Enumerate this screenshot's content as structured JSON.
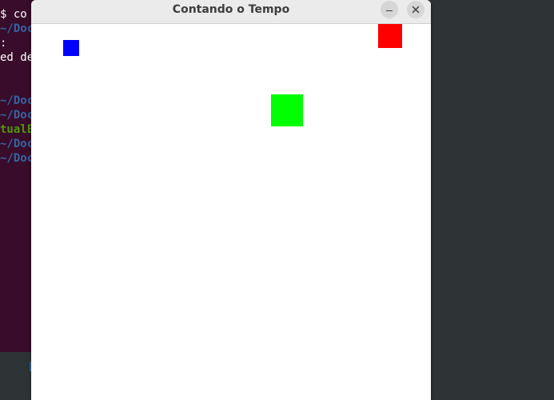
{
  "window": {
    "title": "Contando o Tempo"
  },
  "terminal": {
    "lines": [
      {
        "text": "$ co",
        "style": "white"
      },
      {
        "text": "~/Doc",
        "style": "blue"
      },
      {
        "text": ":",
        "style": "white"
      },
      {
        "text": "ed de",
        "style": "white"
      },
      {
        "text": "~/Doc",
        "style": "blue"
      },
      {
        "text": "~/Doc",
        "style": "blue"
      },
      {
        "text": "tualE",
        "style": "green"
      },
      {
        "text": "~/Doc",
        "style": "blue"
      },
      {
        "text": "~/Doc",
        "style": "blue"
      }
    ]
  },
  "squares": {
    "blue": "#0000ff",
    "red": "#ff0000",
    "green": "#00ff00"
  },
  "icons": {
    "minimize": "minimize-icon",
    "close": "close-icon"
  }
}
